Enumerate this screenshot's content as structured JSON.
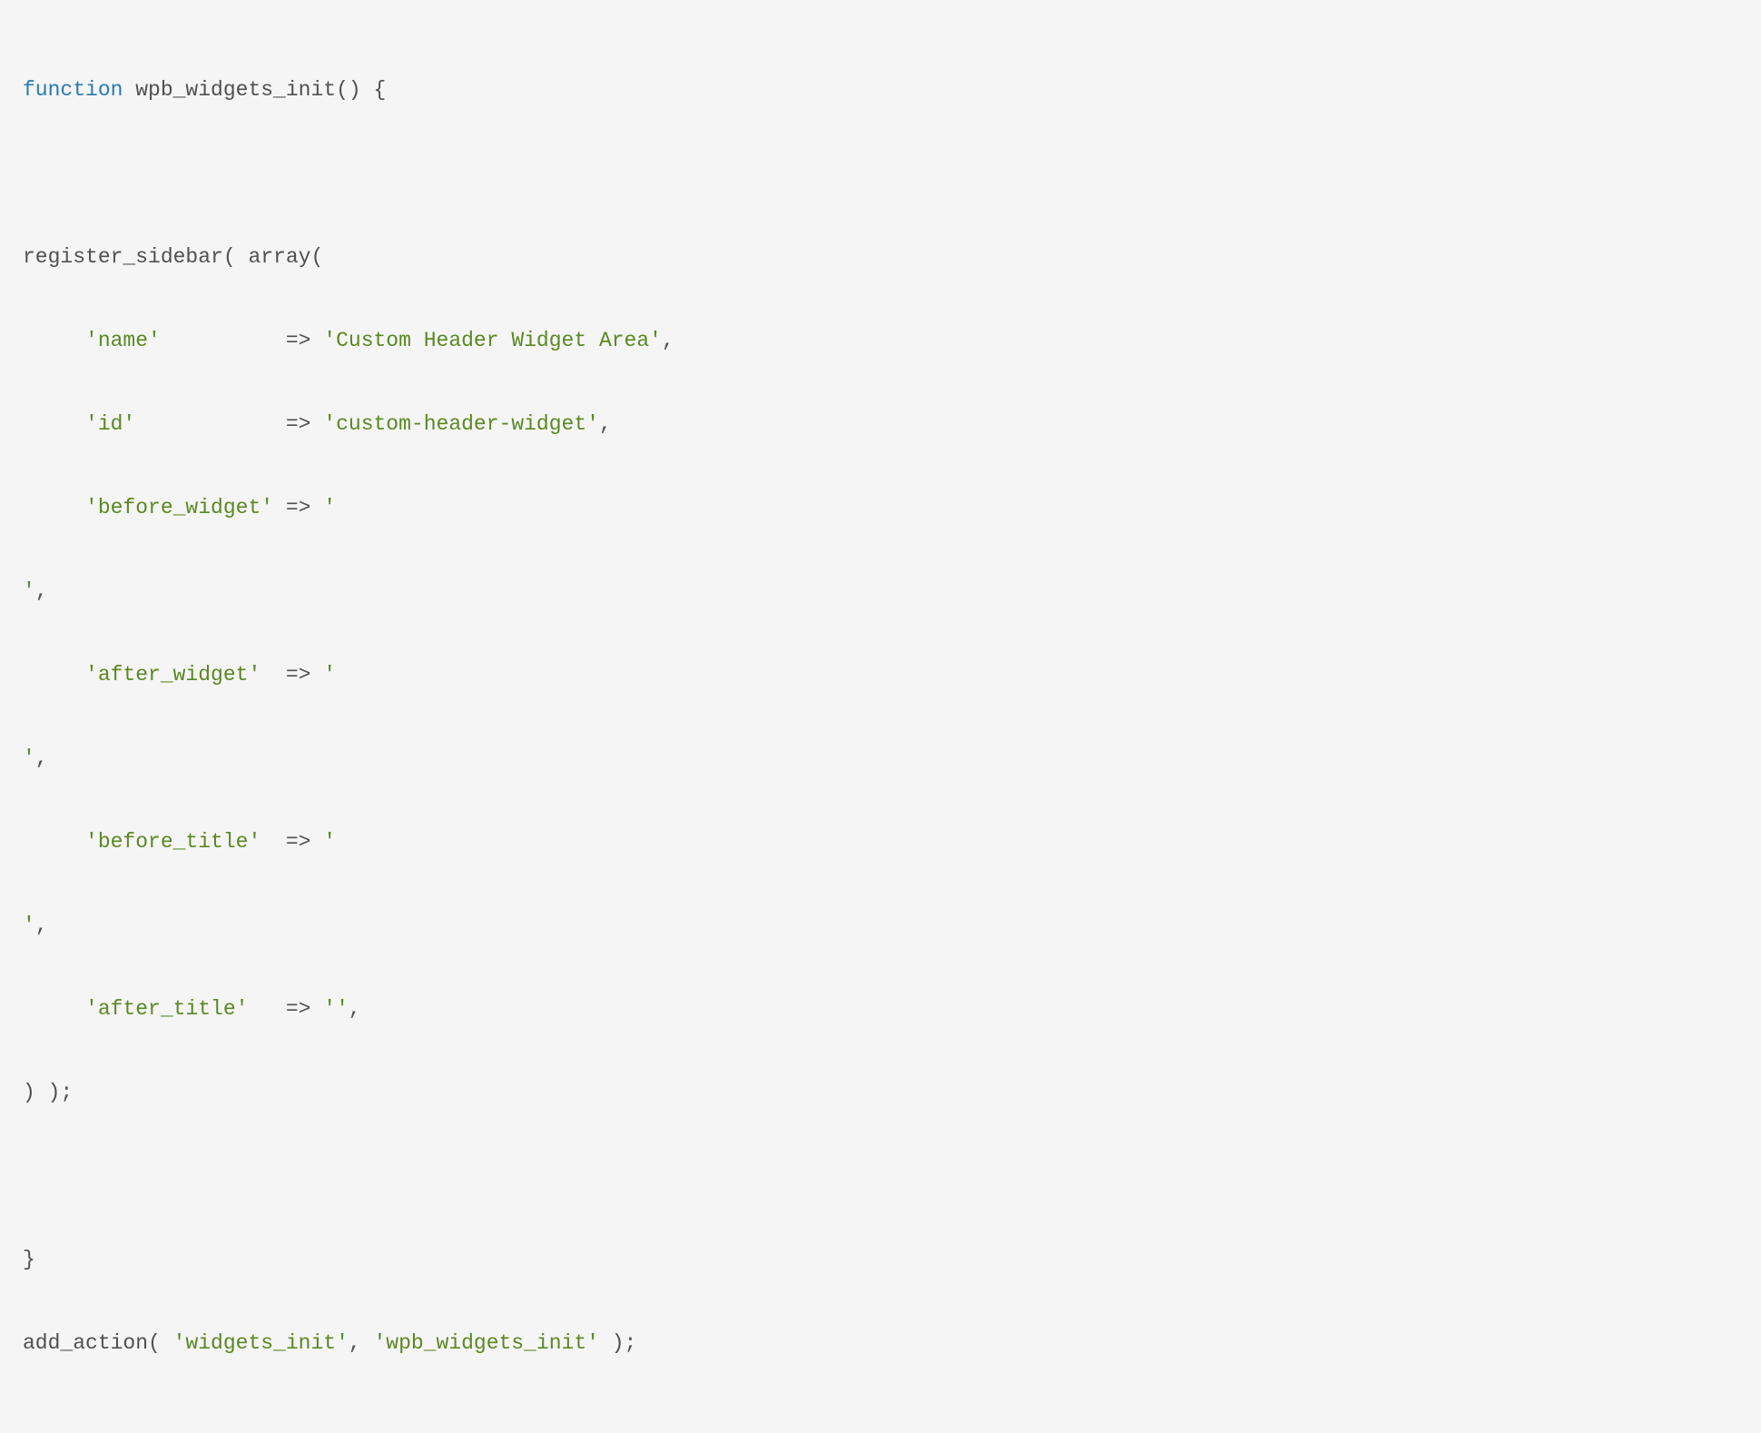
{
  "code": {
    "line1": {
      "keyword": "function",
      "name": " wpb_widgets_init",
      "parens": "()",
      "brace": " {"
    },
    "line2": {
      "name": "register_sidebar",
      "open": "( ",
      "array": "array",
      "paren": "("
    },
    "line3": {
      "indent": "     ",
      "key": "'name'",
      "pad": "          ",
      "arrow": "=> ",
      "value": "'Custom Header Widget Area'",
      "comma": ","
    },
    "line4": {
      "indent": "     ",
      "key": "'id'",
      "pad": "            ",
      "arrow": "=> ",
      "value": "'custom-header-widget'",
      "comma": ","
    },
    "line5": {
      "indent": "     ",
      "key": "'before_widget'",
      "pad": " ",
      "arrow": "=> ",
      "value": "'"
    },
    "line6": {
      "value": "'",
      "comma": ","
    },
    "line7": {
      "indent": "     ",
      "key": "'after_widget'",
      "pad": "  ",
      "arrow": "=> ",
      "value": "'"
    },
    "line8": {
      "value": "'",
      "comma": ","
    },
    "line9": {
      "indent": "     ",
      "key": "'before_title'",
      "pad": "  ",
      "arrow": "=> ",
      "value": "'"
    },
    "line10": {
      "value": "'",
      "comma": ","
    },
    "line11": {
      "indent": "     ",
      "key": "'after_title'",
      "pad": "   ",
      "arrow": "=> ",
      "value": "''",
      "comma": ","
    },
    "line12": {
      "close": ") );"
    },
    "line13": {
      "brace": "}"
    },
    "line14": {
      "name": "add_action",
      "open": "( ",
      "arg1": "'widgets_init'",
      "comma": ", ",
      "arg2": "'wpb_widgets_init'",
      "close": " );"
    }
  }
}
